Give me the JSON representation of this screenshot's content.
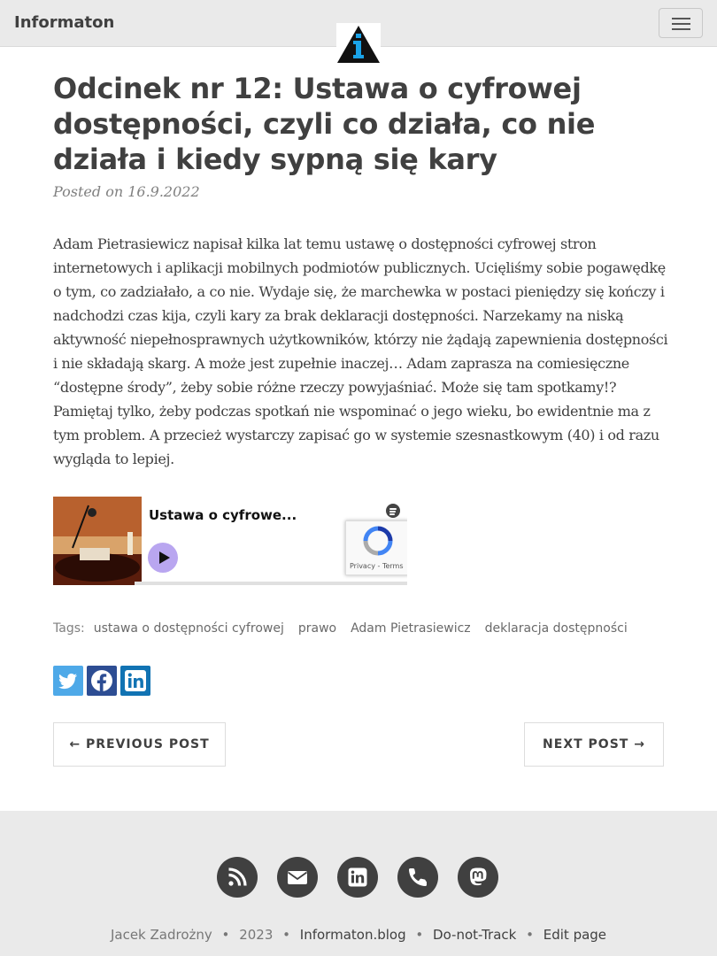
{
  "navbar": {
    "brand": "Informaton",
    "logo": "informaton-logo-triangle",
    "menu_icon": "hamburger-icon"
  },
  "post": {
    "title": "Odcinek nr 12: Ustawa o cyfrowej dostępności, czyli co działa, co nie działa i kiedy sypną się kary",
    "meta": "Posted on 16.9.2022",
    "body": "Adam Pietrasiewicz napisał kilka lat temu ustawę o dostępności cyfrowej stron internetowych i aplikacji mobilnych podmiotów publicznych. Ucięliśmy sobie pogawędkę o tym, co zadziałało, a co nie. Wydaje się, że marchewka w postaci pieniędzy się kończy i nadchodzi czas kija, czyli kary za brak deklaracji dostępności. Narzekamy na niską aktywność niepełnosprawnych użytkowników, którzy nie żądają zapewnienia dostępności i nie składają skarg. A może jest zupełnie inaczej… Adam zaprasza na comiesięczne “dostępne środy”, żeby sobie różne rzeczy powyjaśniać. Może się tam spotkamy!? Pamiętaj tylko, żeby podczas spotkań nie wspominać o jego wieku, bo ewidentnie ma z tym problem. A przecież wystarczy zapisać go w systemie szesnastkowym (40) i od razu wygląda to lepiej."
  },
  "embed": {
    "episode_title": "Ustawa o cyfrowe...",
    "recaptcha_text": "Privacy - Terms",
    "progress": 0
  },
  "tags": {
    "label": "Tags:",
    "items": [
      "ustawa o dostępności cyfrowej",
      "prawo",
      "Adam Pietrasiewicz",
      "deklaracja dostępności"
    ]
  },
  "share": {
    "icons": [
      "twitter-icon",
      "facebook-icon",
      "linkedin-icon"
    ],
    "colors": {
      "twitter": "#4ea9e8",
      "facebook": "#2d4d93",
      "linkedin": "#1173b3"
    }
  },
  "pager": {
    "previous": "← PREVIOUS POST",
    "next": "NEXT POST →"
  },
  "footer": {
    "icons": [
      "rss-icon",
      "envelope-icon",
      "linkedin-icon",
      "phone-icon",
      "mastodon-icon"
    ],
    "author": "Jacek Zadrożny",
    "sep": "•",
    "year": "2023",
    "site": "Informaton.blog",
    "dnt": "Do-not-Track",
    "edit": "Edit page"
  },
  "colors": {
    "text": "#404040",
    "navbar_bg": "#eaeaea",
    "logo_accent": "#1aa3e8"
  }
}
